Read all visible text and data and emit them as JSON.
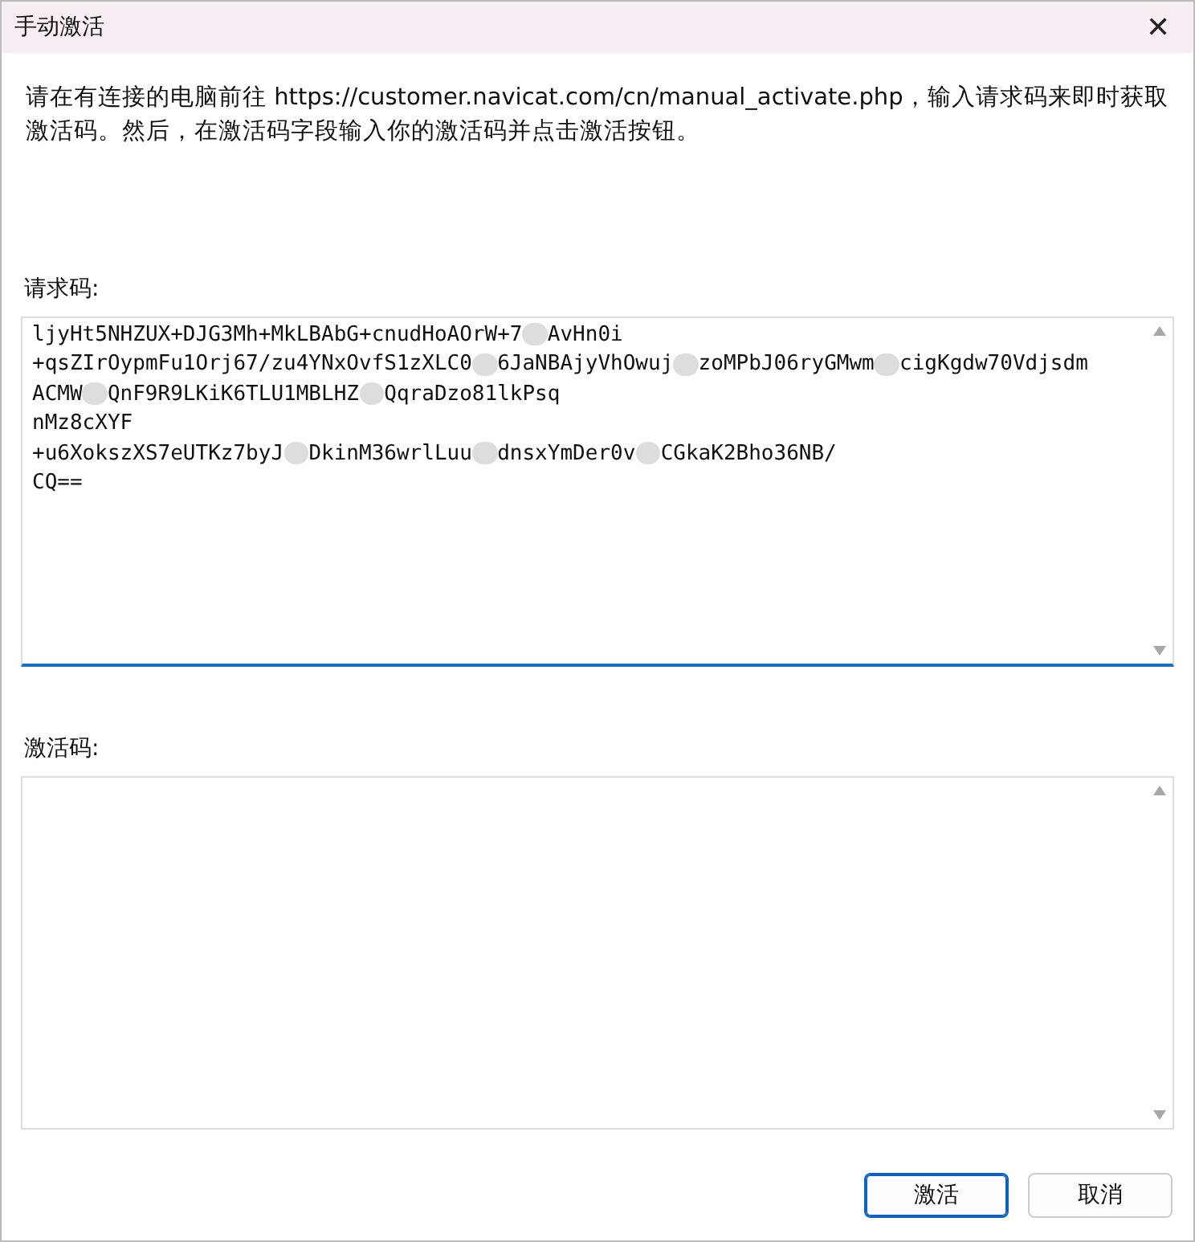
{
  "window": {
    "title": "手动激活",
    "close": "✕"
  },
  "description": "请在有连接的电脑前往 https://customer.navicat.com/cn/manual_activate.php，输入请求码来即时获取激活码。然后，在激活码字段输入你的激活码并点击激活按钮。",
  "request_code": {
    "label": "请求码:",
    "focused": true,
    "lines": [
      {
        "segments": [
          "ljyHt5NHZUX+DJG3Mh+MkLBAbG+cnudHoAOrW+7",
          "AvHn0i"
        ]
      },
      {
        "segments": [
          "+qsZIrOypmFu1Orj67/zu4YNxOvfS1zXLC0",
          "6JaNBAjyVhOwuj",
          "zoMPbJ06ryGMwm",
          "cigKgdw70Vdjsdm"
        ]
      },
      {
        "segments": [
          "ACMW",
          "QnF9R9LKiK6TLU1MBLHZ",
          "QqraDzo81lkPsq"
        ]
      },
      {
        "segments": [
          "nMz8cXYF"
        ]
      },
      {
        "segments": [
          "+u6XokszXS7eUTKz7byJ",
          "DkinM36wrlLuu",
          "dnsxYmDer0v",
          "CGkaK2Bho36NB/"
        ]
      },
      {
        "segments": [
          "CQ=="
        ]
      }
    ]
  },
  "activation_code": {
    "label": "激活码:",
    "focused": false
  },
  "buttons": [
    {
      "label": "激活",
      "default": true
    },
    {
      "label": "取消",
      "default": false
    }
  ]
}
